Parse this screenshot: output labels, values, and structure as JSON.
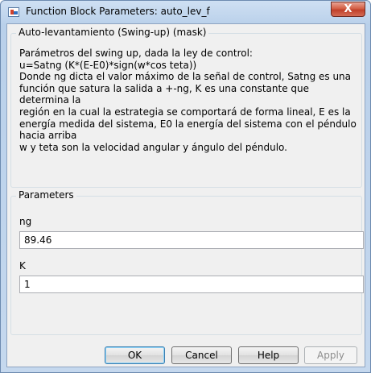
{
  "window": {
    "title": "Function Block Parameters: auto_lev_f",
    "close_symbol": "X"
  },
  "mask_group": {
    "title": "Auto-levantamiento (Swing-up) (mask)",
    "description_lines": [
      "Parámetros del swing up, dada la ley de control:",
      "u=Satng (K*(E-E0)*sign(w*cos teta))",
      "Donde ng dicta el valor máximo de la señal de control, Satng es una",
      "función que satura la salida a +-ng, K es una constante que",
      "determina la",
      "región en la cual la estrategia se comportará de forma lineal, E es la",
      "energía medida del sistema, E0 la energía del sistema con el péndulo",
      "hacia arriba",
      "w y teta son la velocidad angular y ángulo del péndulo."
    ]
  },
  "parameters_group": {
    "title": "Parameters",
    "fields": [
      {
        "label": "ng",
        "value": "89.46"
      },
      {
        "label": "K",
        "value": "1"
      }
    ]
  },
  "buttons": {
    "ok": "OK",
    "cancel": "Cancel",
    "help": "Help",
    "apply": "Apply"
  },
  "icons": {
    "app": "simulink-block-icon",
    "close": "close-icon"
  }
}
